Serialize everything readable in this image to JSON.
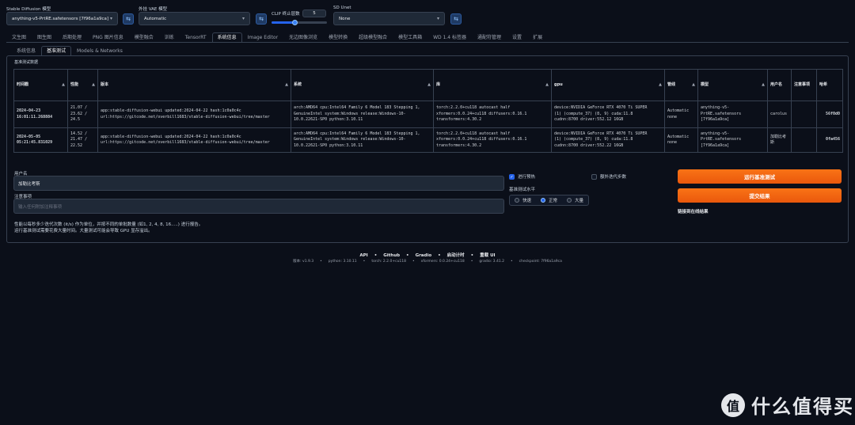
{
  "header": {
    "sd_model_label": "Stable Diffusion 模型",
    "sd_model_value": "anything-v5-PrtRE.safetensors [7f96a1a9ca]",
    "vae_label": "外挂 VAE 模型",
    "vae_value": "Automatic",
    "clip_label": "CLIP 终止层数",
    "clip_value": "5",
    "clip_fraction": 0.42,
    "unet_label": "SD Unet",
    "unet_value": "None",
    "refresh_icon": "refresh-icon"
  },
  "tabs": [
    "文生图",
    "图生图",
    "后期处理",
    "PNG 图片信息",
    "模型融合",
    "训练",
    "TensorRT",
    "系统信息",
    "Image Editor",
    "无边图像浏览",
    "模型转换",
    "超级模型融合",
    "模型工具箱",
    "WD 1.4 标签器",
    "通配符管理",
    "设置",
    "扩展"
  ],
  "active_tab": 7,
  "subtabs": [
    "系统信息",
    "基准测试",
    "Models & Networks"
  ],
  "active_subtab": 1,
  "bench": {
    "title": "基准测试数据",
    "columns": [
      "时间戳",
      "性能",
      "版本",
      "系统",
      "库",
      "gpu",
      "管线",
      "模型",
      "用户名",
      "注意事项",
      "哈希"
    ],
    "rows": [
      [
        "2024-04-23\n16:01:11.268884",
        "21.07 /\n23.62 /\n24.5",
        "app:stable-diffusion-webui updated:2024-04-22 hash:1c0a0c4c\nurl:https://gitcode.net/overbill1683/stable-diffusion-webui/tree/master",
        "arch:AMD64 cpu:Intel64 Family 6 Model 183 Stepping 1,\nGenuineIntel system:Windows release:Windows-10-\n10.0.22621-SP0 python:3.10.11",
        "torch:2.2.0+cu118 autocast half\nxformers:0.0.24+cu118 diffusers:0.16.1\ntransformers:4.30.2",
        "device:NVIDIA GeForce RTX 4070 Ti SUPER\n(1) (compute_37) (8, 9) cuda:11.8\ncudnn:8700 driver:552.12 16GB",
        "Automatic\nnone",
        "anything-v5-\nPrtRE.safetensors\n[7f96a1a9ca]",
        "carolus",
        "",
        "56f0d0"
      ],
      [
        "2024-05-05\n05:21:45.831029",
        "14.52 /\n21.47 /\n22.52",
        "app:stable-diffusion-webui updated:2024-04-22 hash:1c0a0c4c\nurl:https://gitcode.net/overbill1683/stable-diffusion-webui/tree/master",
        "arch:AMD64 cpu:Intel64 Family 6 Model 183 Stepping 1,\nGenuineIntel system:Windows release:Windows-10-\n10.0.22621-SP0 python:3.10.11",
        "torch:2.2.0+cu118 autocast half\nxformers:0.0.24+cu118 diffusers:0.16.1\ntransformers:4.30.2",
        "device:NVIDIA GeForce RTX 4070 Ti SUPER\n(1) (compute_37) (8, 9) cuda:11.8\ncudnn:8700 driver:552.22 16GB",
        "Automatic\nnone",
        "anything-v5-\nPrtRE.safetensors\n[7f96a1a9ca]",
        "加勒比考斯",
        "",
        "0fa456"
      ]
    ]
  },
  "form": {
    "username_label": "用户名",
    "username_value": "加勒比考斯",
    "notes_label": "注意事项",
    "notes_placeholder": "输入任何附加注释事项",
    "help_line1": "性能以每秒多少迭代次数 (it/s) 作为单位，并按不同的单批数量 (如1, 2, 4, 8, 16.....) 进行报告。",
    "help_line2": "运行基准测试需要花费大量时间。大量测试可能会导致 GPU 显存溢出。",
    "warmup_label": "进行预热",
    "warmup_checked": true,
    "extra_steps_label": "额外迭代步数",
    "extra_steps_checked": false,
    "level_label": "基准测试水平",
    "levels": [
      "快速",
      "正常",
      "大量"
    ],
    "level_selected": 1,
    "run_button": "运行基准测试",
    "submit_button": "提交结果",
    "online_link": "链接到在线结果"
  },
  "footer": {
    "links": [
      "API",
      "Github",
      "Gradio",
      "启动计时",
      "重载 UI"
    ],
    "separator": "•",
    "versions": [
      "版本: v1.9.3",
      "python: 3.10.11",
      "torch: 2.2.0+cu118",
      "xformers: 0.0.24+cu118",
      "gradio: 3.41.2",
      "checkpoint: 7f96a1a9ca"
    ]
  },
  "watermark": {
    "logo": "值",
    "text": "什么值得买"
  }
}
